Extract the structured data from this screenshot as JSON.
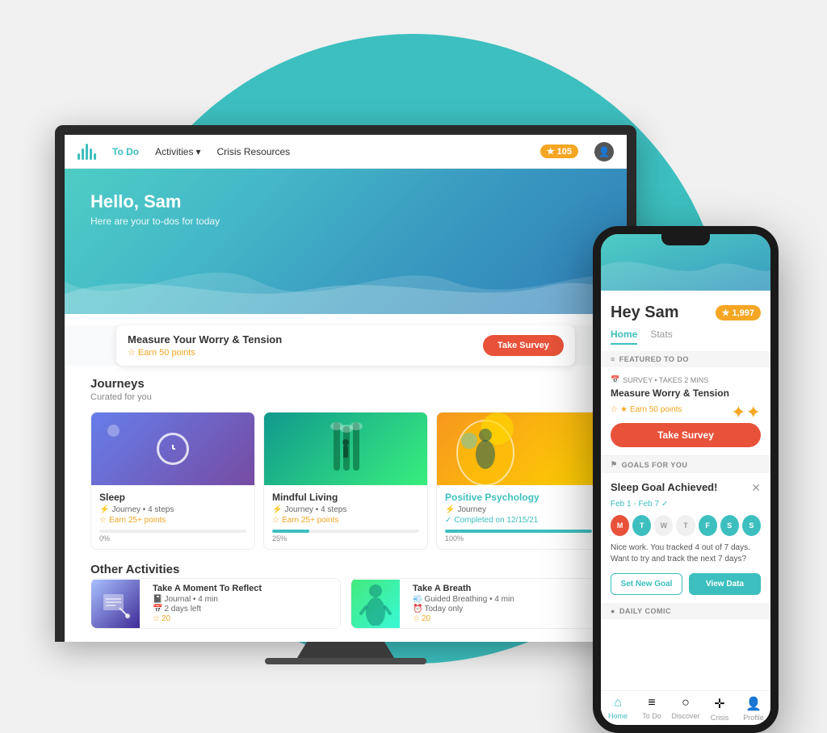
{
  "bg": {
    "circle_color": "#3dbfbf"
  },
  "desktop": {
    "nav": {
      "logo_bars": [
        4,
        7,
        10,
        7,
        4
      ],
      "items": [
        {
          "label": "To Do",
          "active": true
        },
        {
          "label": "Activities",
          "has_arrow": true
        },
        {
          "label": "Crisis Resources"
        }
      ],
      "points": "105",
      "points_icon": "★"
    },
    "hero": {
      "greeting": "Hello, Sam",
      "subtitle": "Here are your to-dos for today"
    },
    "survey": {
      "title": "Measure Your Worry & Tension",
      "earn_label": "Earn 50 points",
      "button_label": "Take Survey"
    },
    "journeys": {
      "section_title": "Journeys",
      "section_subtitle": "Curated for you",
      "cards": [
        {
          "title": "Sleep",
          "meta": "Journey • 4 steps",
          "points": "Earn 25+ points",
          "progress": 0,
          "progress_label": "0%"
        },
        {
          "title": "Mindful Living",
          "meta": "Journey • 4 steps",
          "points": "Earn 25+ points",
          "progress": 25,
          "progress_label": "25%"
        },
        {
          "title": "Positive Psychology",
          "meta": "Journey",
          "points": "Completed on 12/15/21",
          "progress": 100,
          "progress_label": "100%",
          "completed": true
        }
      ]
    },
    "other_activities": {
      "section_title": "Other Activities",
      "cards": [
        {
          "title": "Take A Moment To Reflect",
          "meta1": "Journal • 4 min",
          "meta2": "2 days left",
          "points": "20"
        },
        {
          "title": "Take A Breath",
          "meta1": "Guided Breathing • 4 min",
          "meta2": "Today only",
          "points": "20"
        }
      ]
    }
  },
  "mobile": {
    "greeting": "Hey Sam",
    "points": "1,997",
    "tabs": [
      {
        "label": "Home",
        "active": true
      },
      {
        "label": "Stats"
      }
    ],
    "featured_section": "FEATURED TO DO",
    "survey": {
      "label": "SURVEY • TAKES 2 MINS",
      "title": "Measure Worry & Tension",
      "earn_label": "Earn 50 points",
      "button_label": "Take Survey"
    },
    "goals_section": "GOALS FOR YOU",
    "goal": {
      "title": "Sleep Goal Achieved!",
      "date_range": "Feb 1 - Feb 7",
      "week_days": [
        {
          "label": "M",
          "state": "active"
        },
        {
          "label": "T",
          "state": "completed"
        },
        {
          "label": "W",
          "state": "inactive"
        },
        {
          "label": "T",
          "state": "inactive"
        },
        {
          "label": "F",
          "state": "completed"
        },
        {
          "label": "S",
          "state": "completed"
        },
        {
          "label": "S",
          "state": "completed"
        }
      ],
      "description": "Nice work. You tracked 4 out of 7 days. Want to try and track the next 7 days?",
      "btn_set": "Set New Goal",
      "btn_view": "View Data"
    },
    "daily_section": "DAILY COMIC",
    "bottom_nav": [
      {
        "label": "Home",
        "icon": "⌂",
        "active": true
      },
      {
        "label": "To Do",
        "icon": "≡"
      },
      {
        "label": "Discover",
        "icon": "○"
      },
      {
        "label": "Crisis",
        "icon": "✛"
      },
      {
        "label": "Profile",
        "icon": "👤"
      }
    ]
  }
}
